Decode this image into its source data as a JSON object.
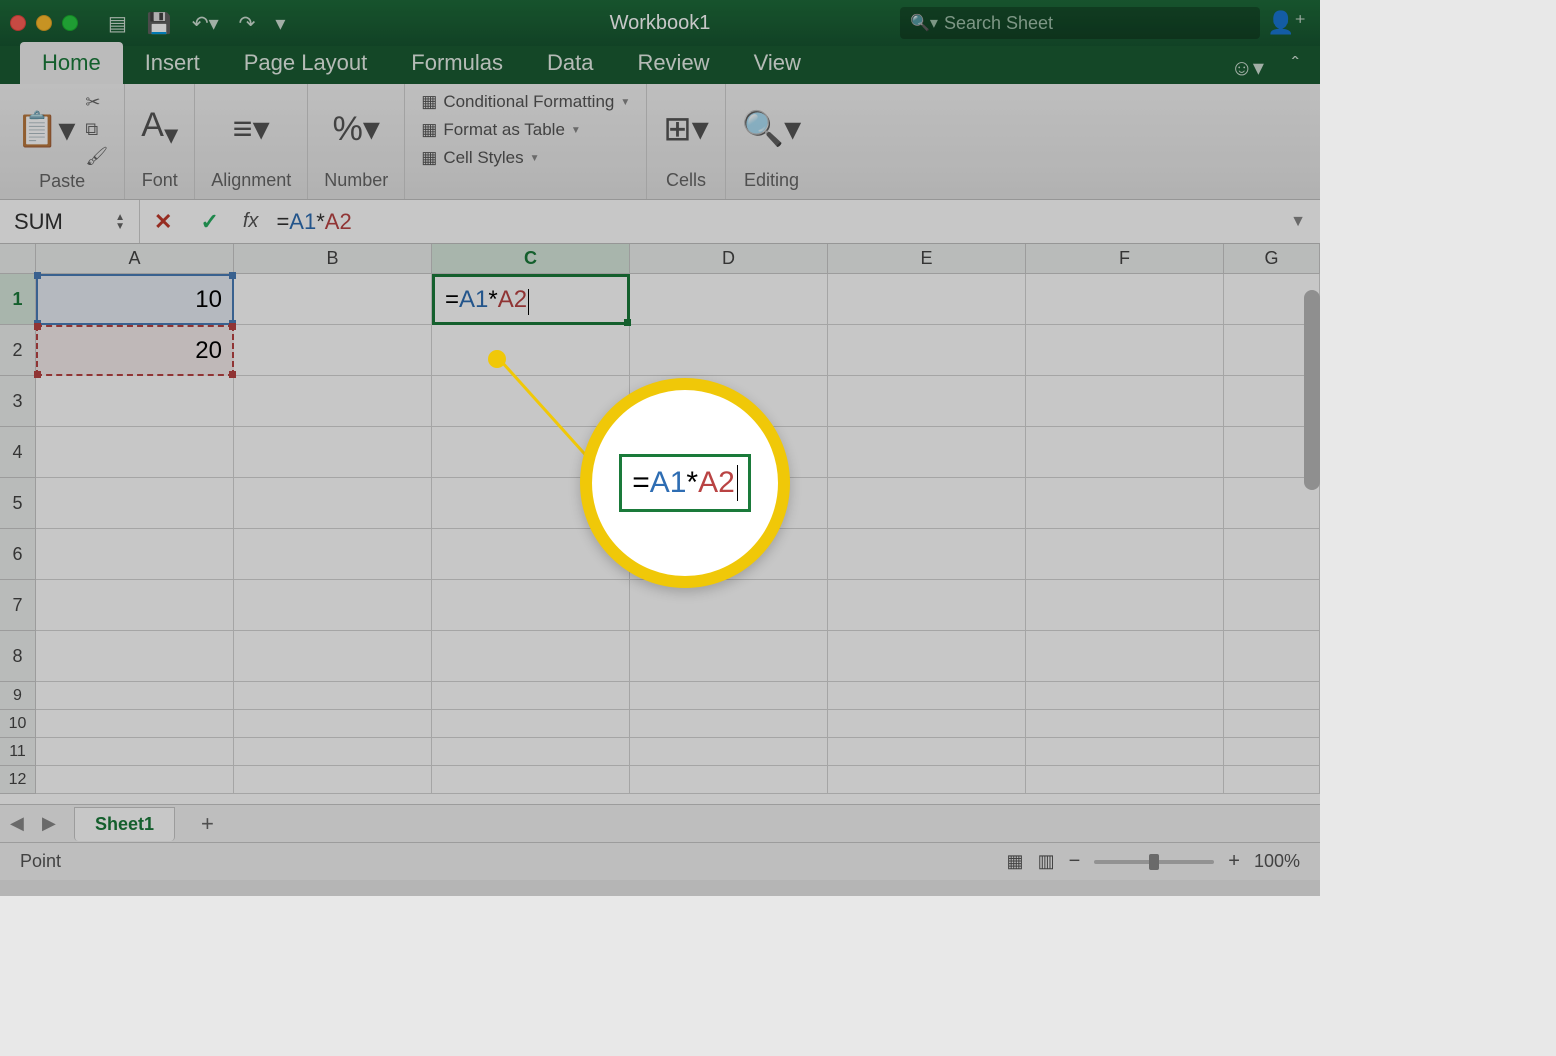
{
  "titlebar": {
    "document_title": "Workbook1",
    "search_placeholder": "Search Sheet"
  },
  "ribbon_tabs": {
    "tabs": [
      "Home",
      "Insert",
      "Page Layout",
      "Formulas",
      "Data",
      "Review",
      "View"
    ],
    "active": "Home"
  },
  "ribbon": {
    "paste_label": "Paste",
    "font_label": "Font",
    "alignment_label": "Alignment",
    "number_label": "Number",
    "cond_fmt": "Conditional Formatting",
    "fmt_table": "Format as Table",
    "cell_styles": "Cell Styles",
    "cells_label": "Cells",
    "editing_label": "Editing"
  },
  "formula_bar": {
    "name_box": "SUM",
    "formula_eq": "=",
    "formula_ref1": "A1",
    "formula_op": "*",
    "formula_ref2": "A2"
  },
  "grid": {
    "columns": [
      "A",
      "B",
      "C",
      "D",
      "E",
      "F",
      "G"
    ],
    "rows_large": [
      "1",
      "2",
      "3",
      "4",
      "5",
      "6",
      "7",
      "8"
    ],
    "rows_small": [
      "9",
      "10",
      "11",
      "12"
    ],
    "active_col": "C",
    "active_row": "1",
    "cells": {
      "A1": "10",
      "A2": "20",
      "C1_eq": "=",
      "C1_ref1": "A1",
      "C1_op": "*",
      "C1_ref2": "A2"
    }
  },
  "magnifier": {
    "eq": "=",
    "ref1": "A1",
    "op": "*",
    "ref2": "A2"
  },
  "sheet_tabs": {
    "sheet1": "Sheet1"
  },
  "status_bar": {
    "mode": "Point",
    "zoom": "100%"
  }
}
